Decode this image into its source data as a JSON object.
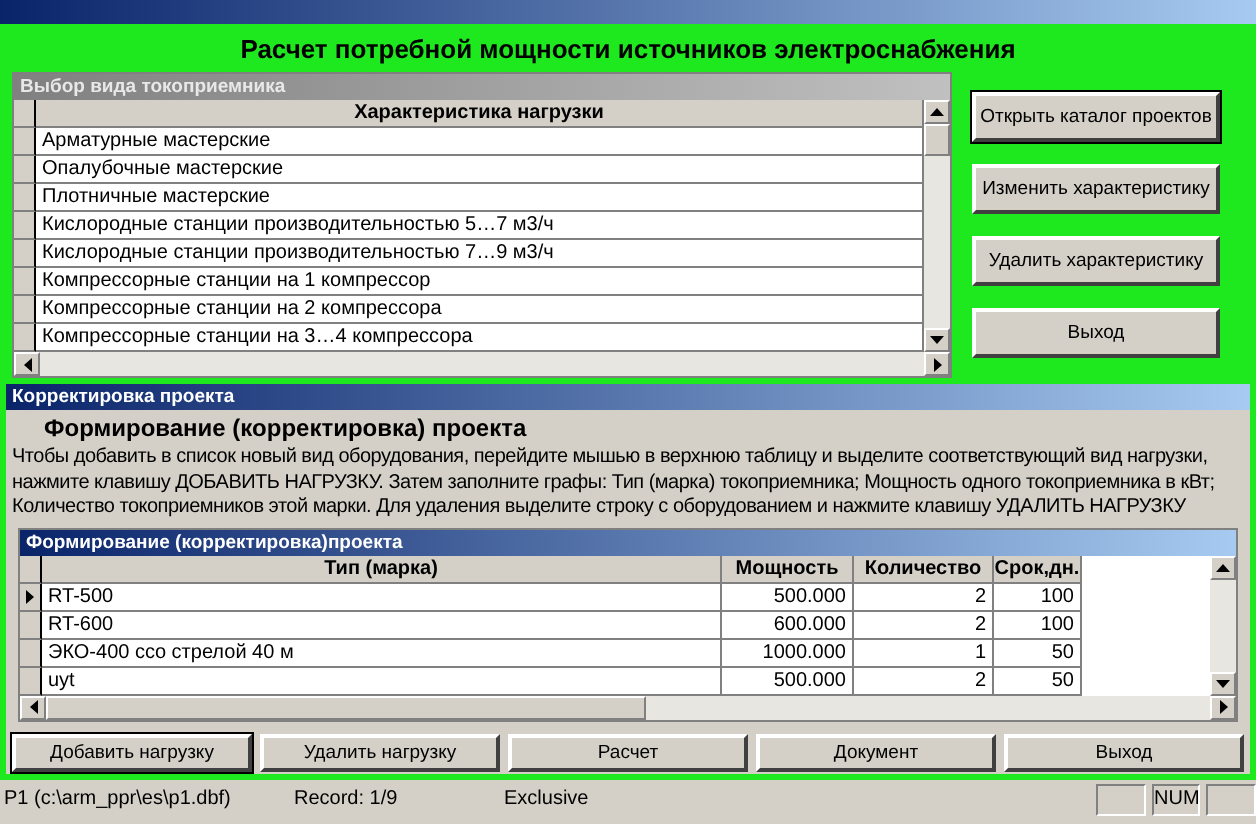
{
  "form": {
    "title": "Расчет потребной мощности источников электроснабжения"
  },
  "load_types": {
    "caption": "Выбор вида токоприемника",
    "column": "Характеристика нагрузки",
    "rows": [
      "Арматурные мастерские",
      "Опалубочные мастерские",
      "Плотничные мастерские",
      "Кислородные станции производительностью 5…7 м3/ч",
      "Кислородные станции производительностью 7…9 м3/ч",
      "Компрессорные станции на 1  компрессор",
      "Компрессорные станции на  2 компрессора",
      "Компрессорные станции на 3…4 компрессора"
    ]
  },
  "side_buttons": [
    {
      "label": "Открыть каталог проектов",
      "default": true
    },
    {
      "label": "Изменить характеристику",
      "default": false
    },
    {
      "label": "Удалить характеристику",
      "default": false
    },
    {
      "label": "Выход",
      "default": false
    }
  ],
  "project": {
    "window_title": "Корректировка проекта",
    "heading": "Формирование (корректировка) проекта",
    "instructions": "Чтобы добавить в список новый вид оборудования, перейдите мышью в верхнюю таблицу и выделите соответствующий вид нагрузки, нажмите клавишу ДОБАВИТЬ НАГРУЗКУ. Затем заполните графы: Тип (марка) токоприемника; Мощность одного токоприемника в кВт; Количество токоприемников этой марки. Для удаления выделите строку с оборудованием и нажмите клавишу УДАЛИТЬ НАГРУЗКУ",
    "table_caption": "Формирование (корректировка)проекта",
    "columns": [
      "Тип (марка)",
      "Мощность",
      "Количество",
      "Срок,дн."
    ],
    "rows": [
      {
        "cells": [
          "RT-500",
          "500.000",
          "2",
          "100"
        ],
        "selected": true
      },
      {
        "cells": [
          "RT-600",
          "600.000",
          "2",
          "100"
        ],
        "selected": false
      },
      {
        "cells": [
          "ЭКО-400 cco стрелой 40 м",
          "1000.000",
          "1",
          "50"
        ],
        "selected": false
      },
      {
        "cells": [
          "uyt",
          "500.000",
          "2",
          "50"
        ],
        "selected": false
      }
    ]
  },
  "bottom_buttons": [
    {
      "label": "Добавить нагрузку",
      "default": true
    },
    {
      "label": "Удалить нагрузку",
      "default": false
    },
    {
      "label": "Расчет",
      "default": false
    },
    {
      "label": "Документ",
      "default": false
    },
    {
      "label": "Выход",
      "default": false
    }
  ],
  "status_bar": {
    "file": "P1 (c:\\arm_ppr\\es\\p1.dbf)",
    "record": "Record: 1/9",
    "mode": "Exclusive",
    "num": "NUM"
  }
}
